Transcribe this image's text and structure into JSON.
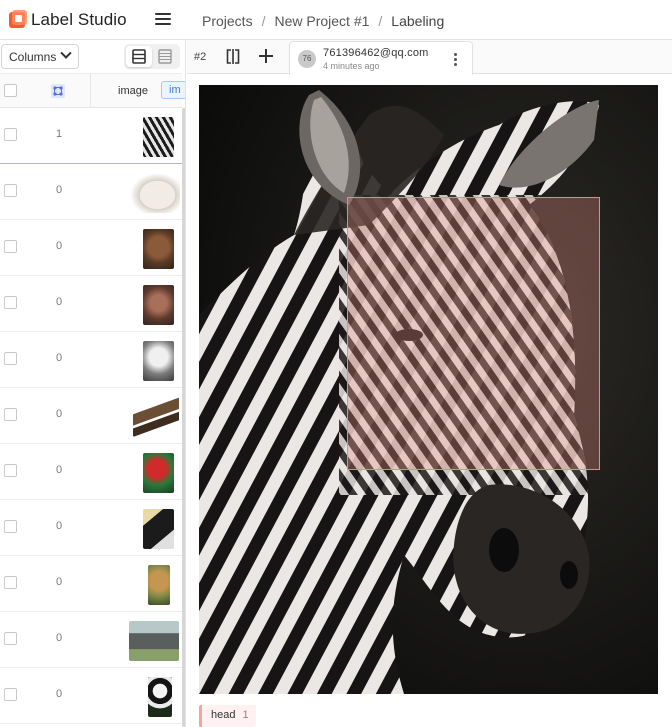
{
  "app": {
    "name": "Label Studio",
    "brand_color": "#f25b2b"
  },
  "breadcrumbs": [
    "Projects",
    "New Project #1",
    "Labeling"
  ],
  "left_panel": {
    "columns_label": "Columns",
    "column_header": "image",
    "column_tag": "im",
    "rows": [
      {
        "count": "1",
        "thumb": "zebra",
        "selected": true
      },
      {
        "count": "0",
        "thumb": "polar-bear"
      },
      {
        "count": "0",
        "thumb": "bear"
      },
      {
        "count": "0",
        "thumb": "monkey"
      },
      {
        "count": "0",
        "thumb": "white-monkey"
      },
      {
        "count": "0",
        "thumb": "eagle"
      },
      {
        "count": "0",
        "thumb": "parrot"
      },
      {
        "count": "0",
        "thumb": "hornbill"
      },
      {
        "count": "0",
        "thumb": "lion"
      },
      {
        "count": "0",
        "thumb": "raccoon"
      },
      {
        "count": "0",
        "thumb": "panda"
      }
    ]
  },
  "task": {
    "number": "#2",
    "annotation": {
      "avatar": "76",
      "user": "761396462@qq.com",
      "time": "4 minutes ago"
    }
  },
  "region": {
    "label": "head",
    "hotkey": "1",
    "color": "#f2a4a0"
  }
}
